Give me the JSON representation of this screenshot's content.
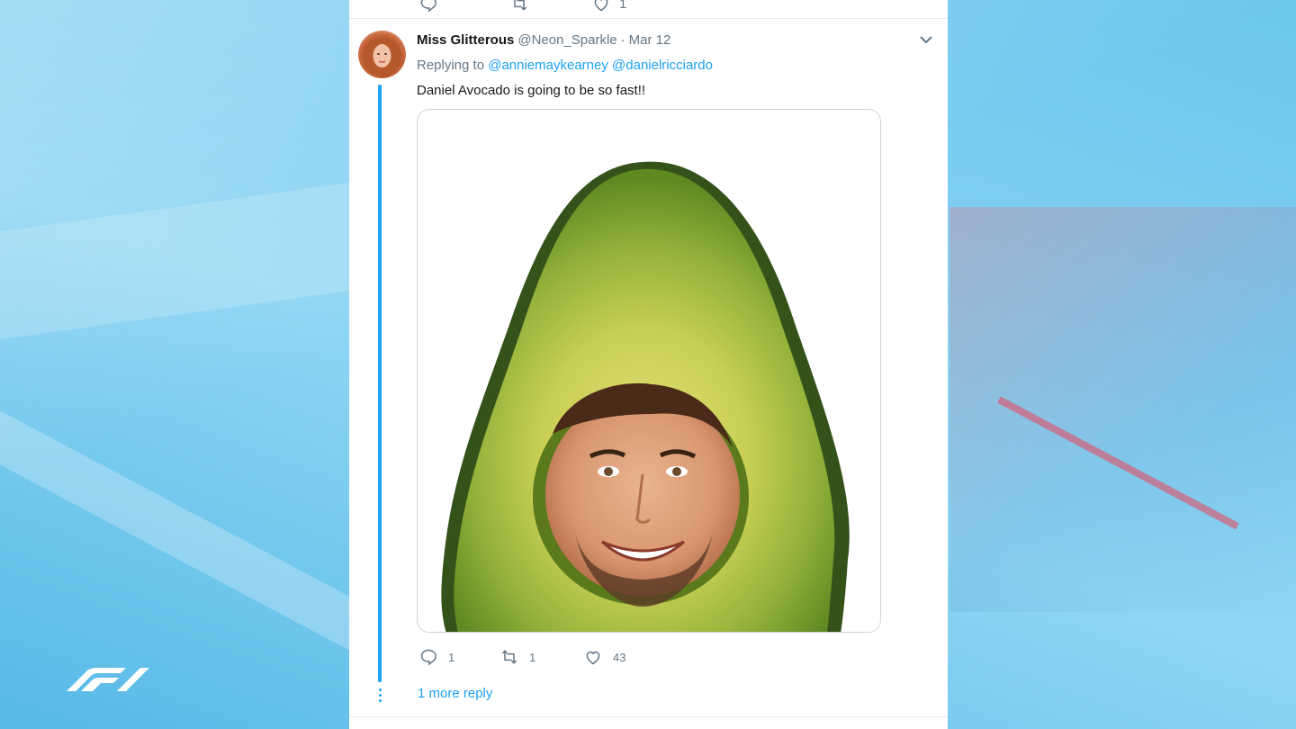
{
  "tweet": {
    "display_name": "Miss Glitterous",
    "handle": "@Neon_Sparkle",
    "separator": "·",
    "date": "Mar 12",
    "replying_prefix": "Replying to",
    "mentions": [
      "@anniemaykearney",
      "@danielricciardo"
    ],
    "text": "Daniel Avocado is going to be so fast!!",
    "actions": {
      "replies": "1",
      "retweets": "1",
      "likes": "43"
    },
    "more_replies": "1 more reply"
  },
  "previous_tweet": {
    "replies": "",
    "likes": "1"
  },
  "icons": {
    "reply": "reply-icon",
    "retweet": "retweet-icon",
    "like": "heart-icon",
    "menu": "chevron-down-icon",
    "brand": "f1-logo"
  },
  "colors": {
    "link": "#1da1f2",
    "muted": "#657786",
    "text": "#14171a",
    "avocado_flesh": "#9bb83a",
    "avocado_skin": "#3a5a12"
  }
}
